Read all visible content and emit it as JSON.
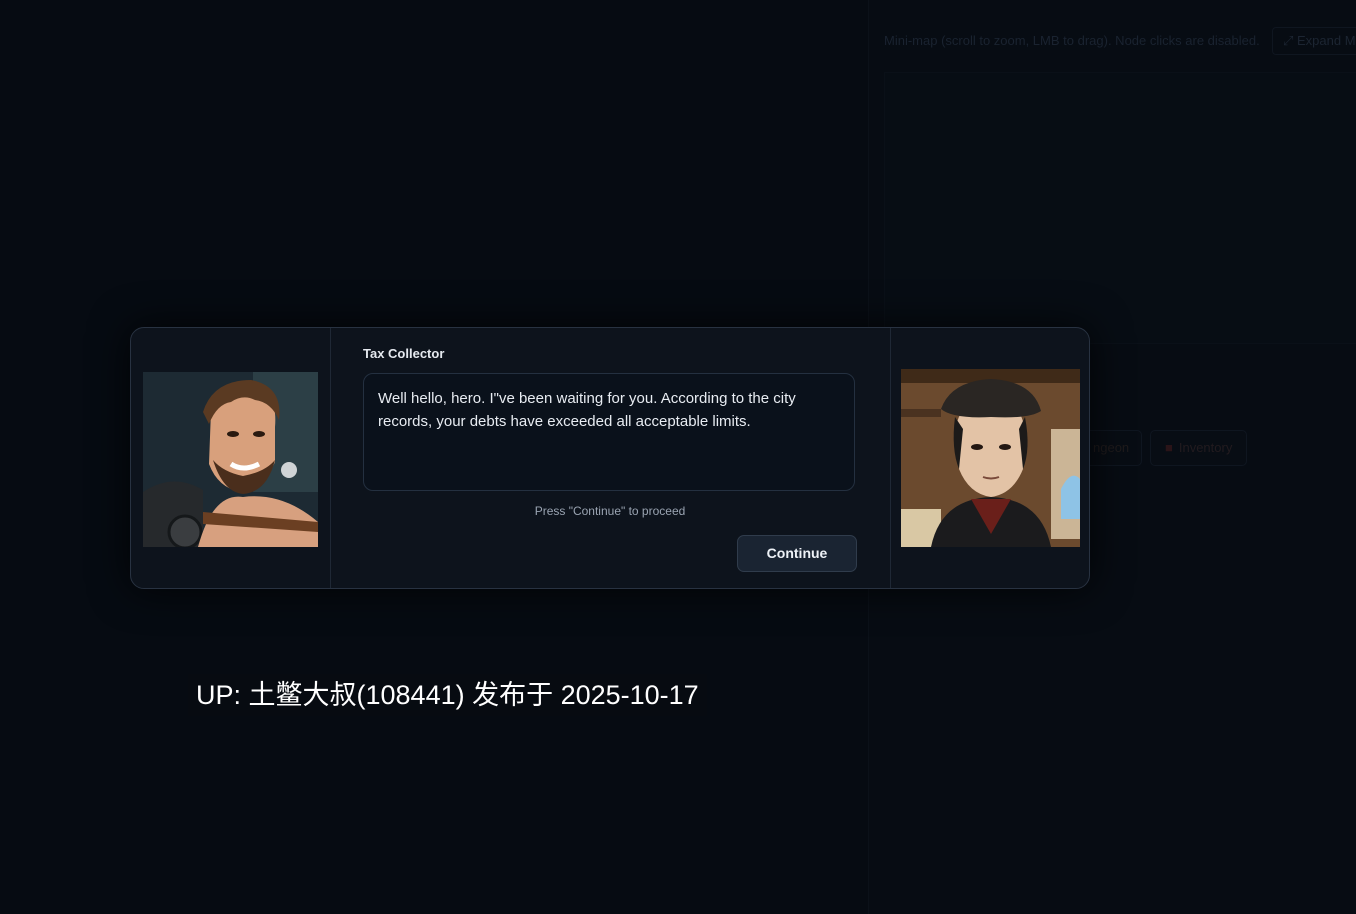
{
  "background": {
    "minimap_hint": "Mini-map (scroll to zoom, LMB to drag). Node clicks are disabled.",
    "expand_map_label": "⤢ Expand Ma",
    "dungeon_button_label": "ngeon",
    "inventory_button_label": "Inventory"
  },
  "dialogue": {
    "speaker": "Tax Collector",
    "text": "Well hello, hero. I\"ve been waiting for you. According to the city records, your debts have exceeded all acceptable limits.",
    "hint": "Press \"Continue\" to proceed",
    "continue_label": "Continue"
  },
  "caption": "UP: 土鳖大叔(108441) 发布于 2025-10-17"
}
